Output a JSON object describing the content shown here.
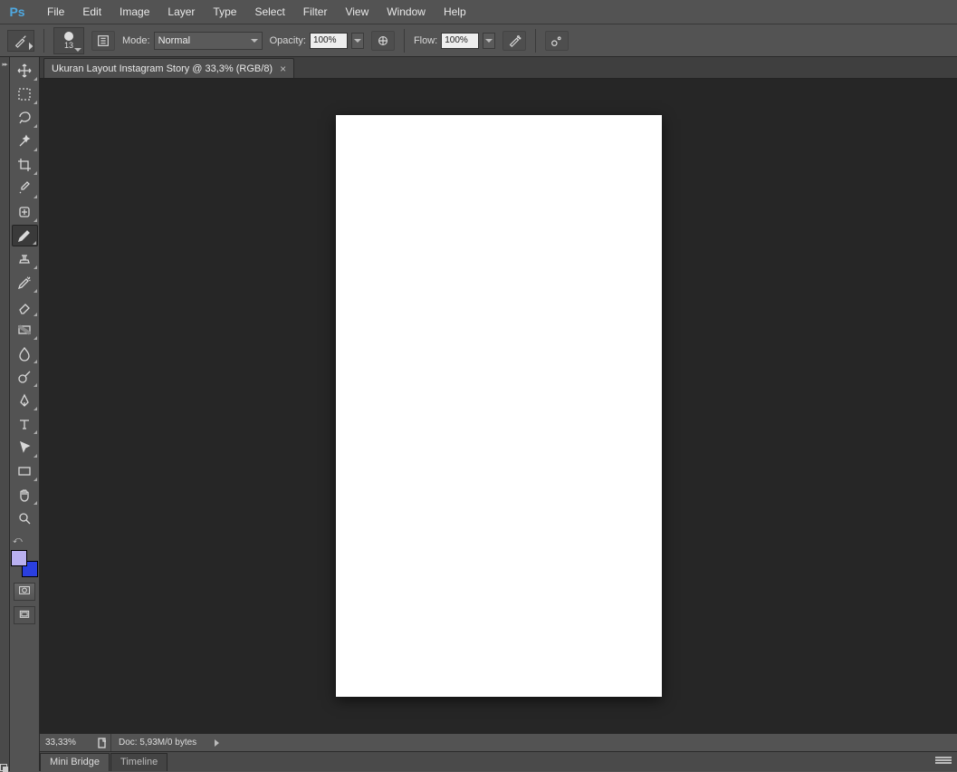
{
  "app": {
    "logo": "Ps"
  },
  "menu": [
    "File",
    "Edit",
    "Image",
    "Layer",
    "Type",
    "Select",
    "Filter",
    "View",
    "Window",
    "Help"
  ],
  "options": {
    "brush_size": "13",
    "mode_label": "Mode:",
    "mode_value": "Normal",
    "opacity_label": "Opacity:",
    "opacity_value": "100%",
    "flow_label": "Flow:",
    "flow_value": "100%"
  },
  "document": {
    "tab_title": "Ukuran Layout Instagram Story @ 33,3% (RGB/8)"
  },
  "status": {
    "zoom": "33,33%",
    "doc_label": "Doc:",
    "doc_value": "5,93M/0 bytes"
  },
  "bottom_panels": {
    "tab1": "Mini Bridge",
    "tab2": "Timeline"
  },
  "colors": {
    "foreground": "#b9b0f0",
    "background": "#2a3fe0"
  },
  "tools": [
    {
      "name": "move-tool"
    },
    {
      "name": "marquee-tool"
    },
    {
      "name": "lasso-tool"
    },
    {
      "name": "magic-wand-tool"
    },
    {
      "name": "crop-tool"
    },
    {
      "name": "eyedropper-tool"
    },
    {
      "name": "healing-brush-tool"
    },
    {
      "name": "brush-tool",
      "active": true
    },
    {
      "name": "clone-stamp-tool"
    },
    {
      "name": "history-brush-tool"
    },
    {
      "name": "eraser-tool"
    },
    {
      "name": "gradient-tool"
    },
    {
      "name": "blur-tool"
    },
    {
      "name": "dodge-tool"
    },
    {
      "name": "pen-tool"
    },
    {
      "name": "type-tool"
    },
    {
      "name": "path-selection-tool"
    },
    {
      "name": "rectangle-tool"
    },
    {
      "name": "hand-tool"
    },
    {
      "name": "zoom-tool"
    }
  ]
}
